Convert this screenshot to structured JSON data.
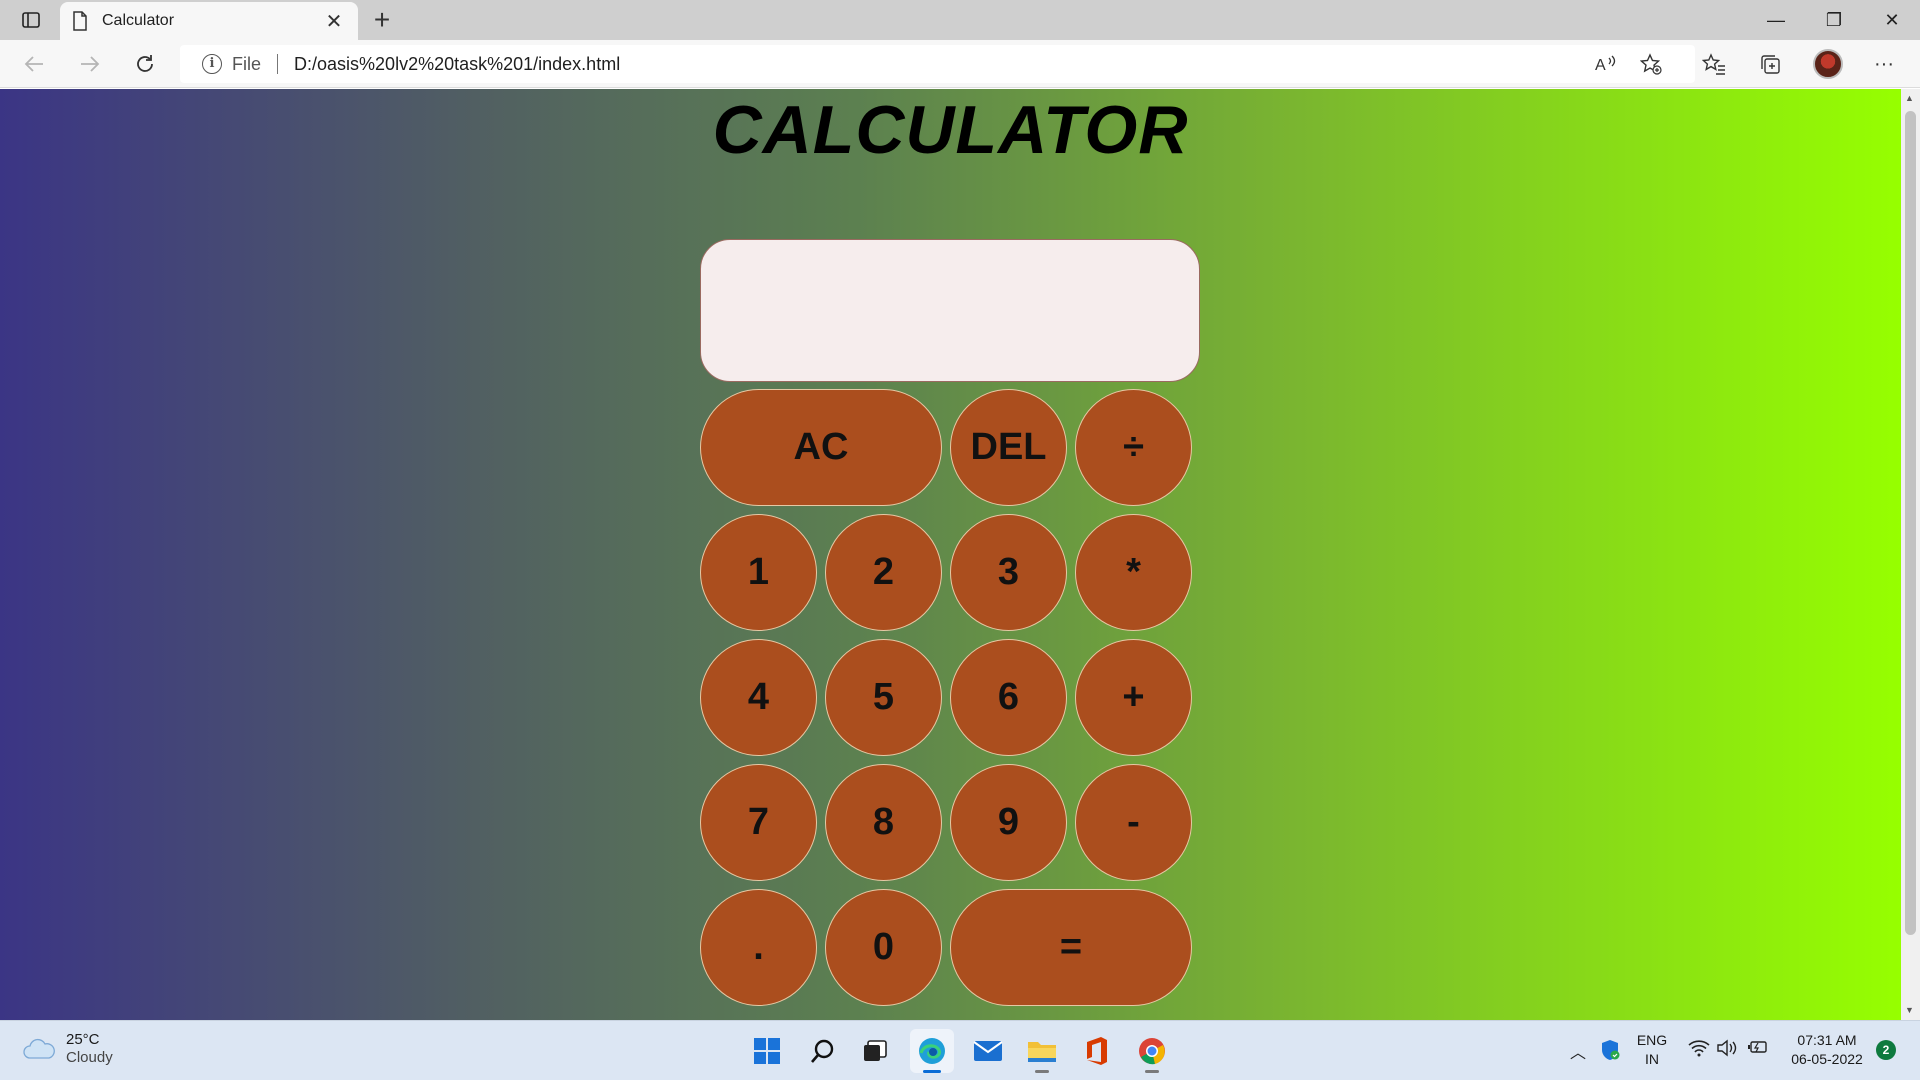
{
  "browser": {
    "tab_title": "Calculator",
    "tab_close": "✕",
    "new_tab": "+",
    "address_scheme": "File",
    "address_url": "D:/oasis%20lv2%20task%201/index.html",
    "window_controls": {
      "minimize": "—",
      "restore": "❐",
      "close": "✕"
    },
    "toolbar_icons": [
      "read-aloud-icon",
      "add-favorite-icon",
      "favorites-icon",
      "collections-icon",
      "profile-avatar",
      "more-icon"
    ],
    "more_label": "···"
  },
  "page": {
    "title": "CALCULATOR",
    "display_value": "",
    "keys": [
      {
        "label": "AC",
        "name": "key-all-clear"
      },
      {
        "label": "DEL",
        "name": "key-delete"
      },
      {
        "label": "÷",
        "name": "key-divide"
      },
      {
        "label": "1",
        "name": "key-1"
      },
      {
        "label": "2",
        "name": "key-2"
      },
      {
        "label": "3",
        "name": "key-3"
      },
      {
        "label": "*",
        "name": "key-multiply"
      },
      {
        "label": "4",
        "name": "key-4"
      },
      {
        "label": "5",
        "name": "key-5"
      },
      {
        "label": "6",
        "name": "key-6"
      },
      {
        "label": "+",
        "name": "key-plus"
      },
      {
        "label": "7",
        "name": "key-7"
      },
      {
        "label": "8",
        "name": "key-8"
      },
      {
        "label": "9",
        "name": "key-9"
      },
      {
        "label": "-",
        "name": "key-minus"
      },
      {
        "label": ".",
        "name": "key-decimal"
      },
      {
        "label": "0",
        "name": "key-0"
      },
      {
        "label": "=",
        "name": "key-equals"
      }
    ],
    "colors": {
      "key_fill": "#ab4e1e",
      "display_fill": "#f6eded",
      "gradient_start": "#3b3585",
      "gradient_end": "#96ff00"
    }
  },
  "taskbar": {
    "weather_temp": "25°C",
    "weather_condition": "Cloudy",
    "apps": [
      "start-icon",
      "search-icon",
      "task-view-icon",
      "edge-icon",
      "mail-icon",
      "file-explorer-icon",
      "office-icon",
      "chrome-icon"
    ],
    "language_top": "ENG",
    "language_bottom": "IN",
    "time": "07:31 AM",
    "date": "06-05-2022",
    "notification_count": "2"
  }
}
